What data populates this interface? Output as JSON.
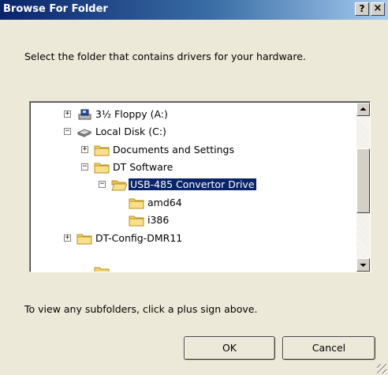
{
  "window": {
    "title": "Browse For Folder",
    "help_label": "?",
    "close_label": "×"
  },
  "instruction": "Select the folder that contains drivers for your hardware.",
  "tree": {
    "items": [
      {
        "label": "3½ Floppy (A:)",
        "icon": "floppy-drive-icon",
        "expander": "+"
      },
      {
        "label": "Local Disk (C:)",
        "icon": "hard-disk-icon",
        "expander": "−"
      },
      {
        "label": "Documents and Settings",
        "icon": "folder-icon",
        "expander": "+"
      },
      {
        "label": "DT Software",
        "icon": "folder-icon",
        "expander": "−"
      },
      {
        "label": "USB-485 Convertor Drive",
        "icon": "folder-open-icon",
        "expander": "−",
        "selected": true
      },
      {
        "label": "amd64",
        "icon": "folder-icon"
      },
      {
        "label": "i386",
        "icon": "folder-icon"
      },
      {
        "label": "DT-Config-DMR11",
        "icon": "folder-icon",
        "expander": "+"
      }
    ]
  },
  "hint": "To view any subfolders, click a plus sign above.",
  "buttons": {
    "ok": "OK",
    "cancel": "Cancel"
  },
  "colors": {
    "titlebar": "#0a246a",
    "selection": "#0a246a",
    "folder": "#f5d36b",
    "dialog_bg": "#ece9d8"
  }
}
